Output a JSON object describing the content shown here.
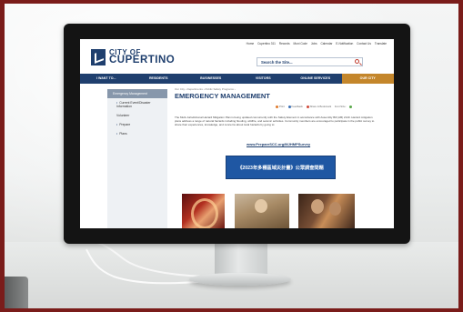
{
  "site": {
    "top_links": [
      "Home",
      "Cupertino 311",
      "Records",
      "Muni Code",
      "Jobs",
      "Calendar",
      "E-Notification",
      "Contact Us",
      "Translate"
    ],
    "logo_line1": "CITY OF",
    "logo_line2": "CUPERTINO",
    "search_placeholder": "Search the Site...",
    "nav": [
      "I WANT TO...",
      "RESIDENTS",
      "BUSINESSES",
      "VISITORS",
      "ONLINE SERVICES",
      "OUR CITY"
    ]
  },
  "sidebar": {
    "items": [
      "Emergency Management",
      "Current Event/Disaster Information",
      "Volunteer",
      "Prepare",
      "Plans"
    ]
  },
  "page": {
    "breadcrumb": "Our City › Departments › Public Safety Programs ›",
    "title": "EMERGENCY MANAGEMENT",
    "tools": [
      "Print",
      "Feedback",
      "Share & Bookmark",
      "Font Size:"
    ],
    "body": "The Multi-Jurisdictional Hazard Mitigation Plan is being updated concurrently with the Safety Element in accordance with Assembly Bill (AB) 2140. Hazard mitigation plans address a range of natural hazards including flooding, wildfire, and seismic activities. Community members are encouraged to participate in the public survey to share their experiences, knowledge, and concerns about local hazards by going to:",
    "survey_link": "www.PrepareSCC.org/MJHMPSurvey",
    "banner": "《2023年多種區域災計畫》公眾調查問題"
  },
  "colors": {
    "brand_navy": "#1f3f6e",
    "accent_gold": "#c4862b",
    "frame_red": "#7a1c1a"
  }
}
